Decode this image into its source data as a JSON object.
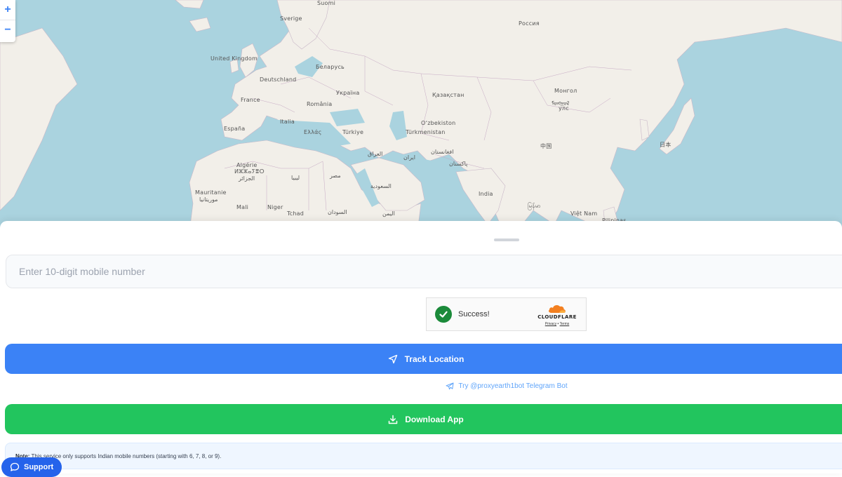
{
  "map": {
    "zoom_in": "+",
    "zoom_out": "−",
    "labels": {
      "sverige": "Sverige",
      "suomi": "Suomi",
      "rossiya": "Россия",
      "uk": "United Kingdom",
      "belarus": "Беларусь",
      "deutschland": "Deutschland",
      "ukraina": "Україна",
      "france": "France",
      "romania": "România",
      "kazakhstan": "Қазақстан",
      "mongolia1": "Монгол",
      "mongolia2": "ᠮᠣᠩᠭᠣᠯ",
      "mongolia3": "улс",
      "espana": "España",
      "italia": "Italia",
      "ellada": "Ελλάς",
      "turkiye": "Türkiye",
      "uzbekistan": "Oʻzbekiston",
      "turkmenistan": "Türkmenistan",
      "china": "中国",
      "japan": "日本",
      "afghanistan": "افغانستان",
      "pakistan": "پاکستان",
      "iraq": "العراق",
      "iran": "ایران",
      "algerie": "Algérie",
      "algerie2": "ⵍⵣⵣⴰⵢⴻⵔ",
      "algerie3": "الجزائر",
      "libya": "ليبيا",
      "egypt": "مصر",
      "saudi": "السعودية",
      "india": "India",
      "mauritanie": "Mauritanie",
      "mauritanie2": "موريتانيا",
      "mali": "Mali",
      "niger": "Niger",
      "tchad": "Tchad",
      "sudan": "السودان",
      "yemen": "اليمن",
      "myanmar": "မြန်မာ",
      "vietnam": "Việt Nam",
      "philippines": "Pilipinas"
    }
  },
  "form": {
    "phone_placeholder": "Enter 10-digit mobile number",
    "phone_value": ""
  },
  "captcha": {
    "status": "Success!",
    "brand": "CLOUDFLARE",
    "privacy": "Privacy",
    "sep": "•",
    "terms": "Terms"
  },
  "actions": {
    "track_label": "Track Location",
    "telegram_label": "Try @proxyearth1bot Telegram Bot",
    "download_label": "Download App"
  },
  "note": {
    "prefix": "Note:",
    "text": " This service only supports Indian mobile numbers (starting with 6, 7, 8, or 9)."
  },
  "support": {
    "label": "Support"
  },
  "colors": {
    "water": "#aad3df",
    "land": "#f2efe9",
    "primary": "#3b82f6",
    "success": "#22c55e",
    "support": "#2563eb"
  }
}
